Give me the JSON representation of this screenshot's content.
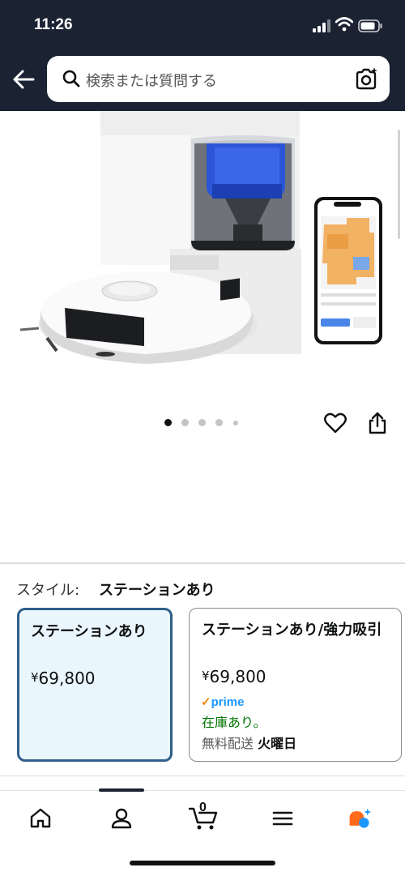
{
  "status_bar": {
    "time": "11:26"
  },
  "search": {
    "placeholder": "検索または質問する"
  },
  "product": {
    "image_alt": "ロボット掃除機とステーション",
    "carousel": {
      "total": 5,
      "active_index": 0
    }
  },
  "style": {
    "label": "スタイル:",
    "selected": "ステーションあり",
    "options": [
      {
        "title": "ステーションあり",
        "price_symbol": "¥",
        "price": "69,800"
      },
      {
        "title": "ステーションあり/強力吸引",
        "price_symbol": "¥",
        "price": "69,800",
        "prime": "prime",
        "stock": "在庫あり。",
        "shipping_prefix": "無料配送",
        "shipping_day": "火曜日"
      }
    ]
  },
  "bottom_nav": {
    "cart_count": "0",
    "active_index": 1
  },
  "colors": {
    "header_bg": "#1b2232",
    "selected_border": "#2f5f8a",
    "selected_bg": "#eaf6fd",
    "prime_blue": "#1a98ff",
    "stock_green": "#007600"
  }
}
